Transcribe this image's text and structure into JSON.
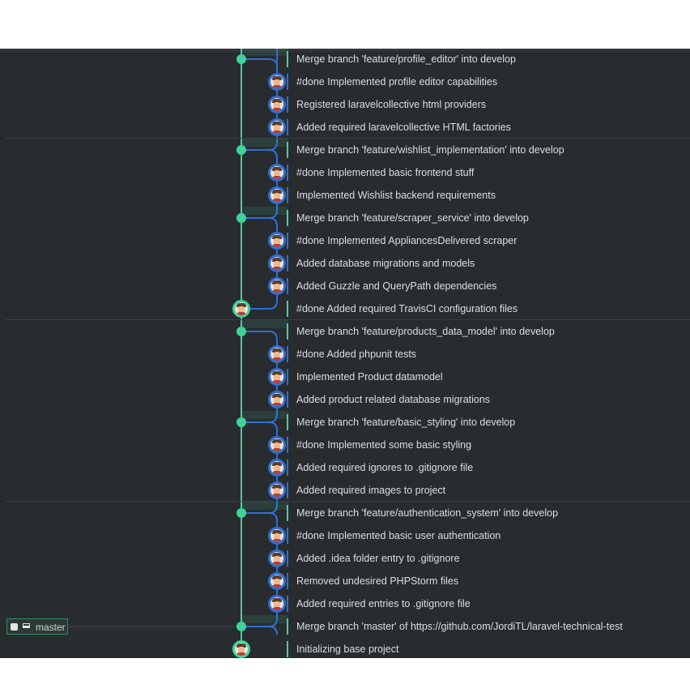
{
  "colors": {
    "main_branch": "#3fd39a",
    "feature_branch": "#2f6fd6",
    "background": "#282c2f",
    "text": "#dcdfe1"
  },
  "branch_tag": {
    "name": "master",
    "icons": [
      "github-icon",
      "laptop-icon"
    ]
  },
  "commits": [
    {
      "message": "Merge branch 'feature/profile_editor' into develop",
      "type": "merge"
    },
    {
      "message": "#done Implemented profile editor capabilities",
      "type": "commit"
    },
    {
      "message": "Registered laravelcollective html providers",
      "type": "commit"
    },
    {
      "message": "Added required laravelcollective HTML factories",
      "type": "commit"
    },
    {
      "message": "Merge branch 'feature/wishlist_implementation' into develop",
      "type": "merge"
    },
    {
      "message": "#done Implemented basic frontend stuff",
      "type": "commit"
    },
    {
      "message": "Implemented Wishlist backend requirements",
      "type": "commit"
    },
    {
      "message": "Merge branch 'feature/scraper_service' into develop",
      "type": "merge"
    },
    {
      "message": "#done Implemented AppliancesDelivered scraper",
      "type": "commit"
    },
    {
      "message": "Added database migrations and models",
      "type": "commit"
    },
    {
      "message": "Added Guzzle and QueryPath dependencies",
      "type": "commit"
    },
    {
      "message": "#done Added required TravisCI configuration files",
      "type": "main"
    },
    {
      "message": "Merge branch 'feature/products_data_model' into develop",
      "type": "merge"
    },
    {
      "message": "#done Added phpunit tests",
      "type": "commit"
    },
    {
      "message": "Implemented Product datamodel",
      "type": "commit"
    },
    {
      "message": "Added product related database migrations",
      "type": "commit"
    },
    {
      "message": "Merge branch 'feature/basic_styling' into develop",
      "type": "merge"
    },
    {
      "message": "#done Implemented some basic styling",
      "type": "commit"
    },
    {
      "message": "Added required ignores to .gitignore file",
      "type": "commit"
    },
    {
      "message": "Added required images to project",
      "type": "commit"
    },
    {
      "message": "Merge branch 'feature/authentication_system' into develop",
      "type": "merge"
    },
    {
      "message": "#done Implemented basic user authentication",
      "type": "commit"
    },
    {
      "message": "Added .idea folder entry to .gitignore",
      "type": "commit"
    },
    {
      "message": "Removed undesired PHPStorm files",
      "type": "commit"
    },
    {
      "message": "Added required entries to .gitignore file",
      "type": "commit"
    },
    {
      "message": "Merge branch 'master' of https://github.com/JordiTL/laravel-technical-test",
      "type": "merge"
    },
    {
      "message": "Initializing base project",
      "type": "main"
    }
  ]
}
